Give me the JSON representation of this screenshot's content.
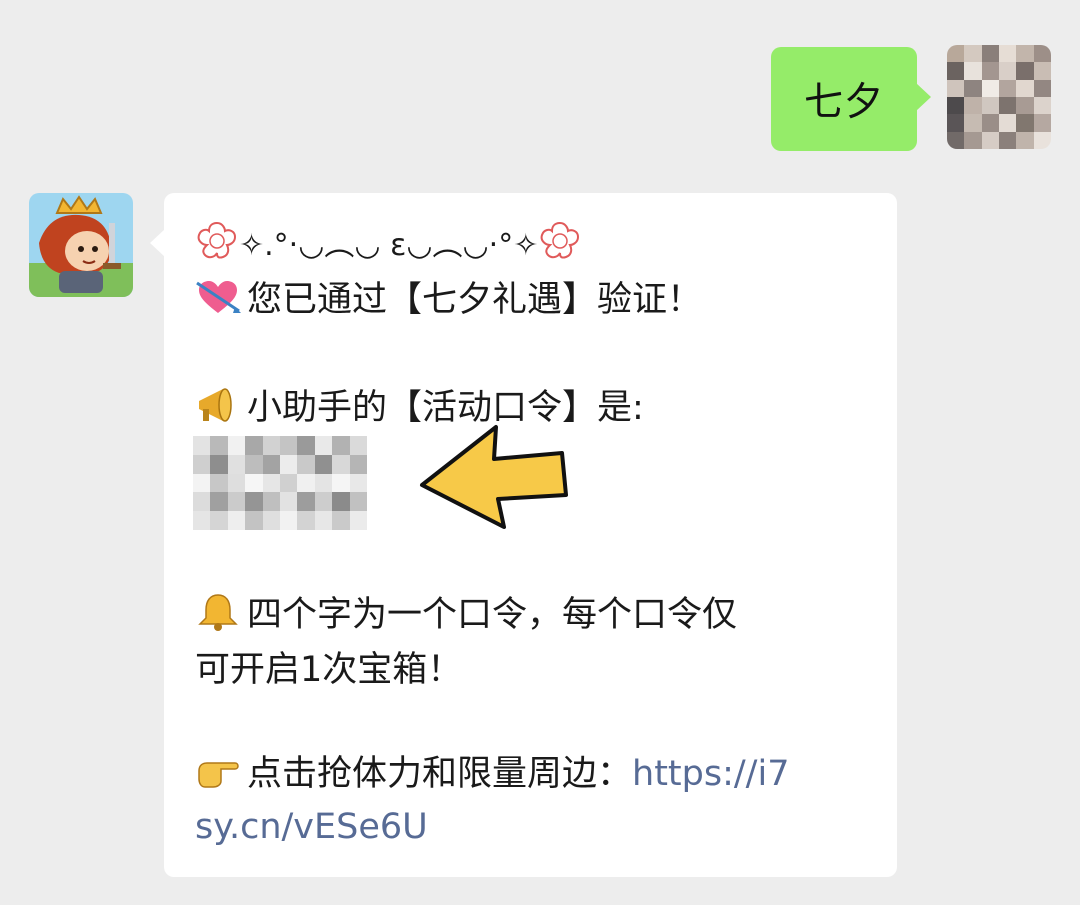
{
  "chat": {
    "user_message": "七夕",
    "bot_message": {
      "header_decor": "✧.°‧◡︵◡ ε◡︵◡‧°✧",
      "line1": "您已通过【七夕礼遇】验证！",
      "line2": "小助手的【活动口令】是:",
      "line3": "四个字为一个口令，每个口令仅",
      "line4": "可开启1次宝箱！",
      "line5_prefix": "点击抢体力和限量周边：",
      "link_part1": "https://i7",
      "link_part2": "sy.cn/vESe6U"
    }
  },
  "colors": {
    "background": "#ededed",
    "user_bubble": "#95ec69",
    "bot_bubble": "#ffffff",
    "link": "#576b95",
    "arrow_fill": "#f7c948"
  },
  "icons": {
    "line1": "heart-arrow-icon",
    "line2": "megaphone-icon",
    "line3": "bell-icon",
    "line5": "pointing-hand-icon"
  }
}
